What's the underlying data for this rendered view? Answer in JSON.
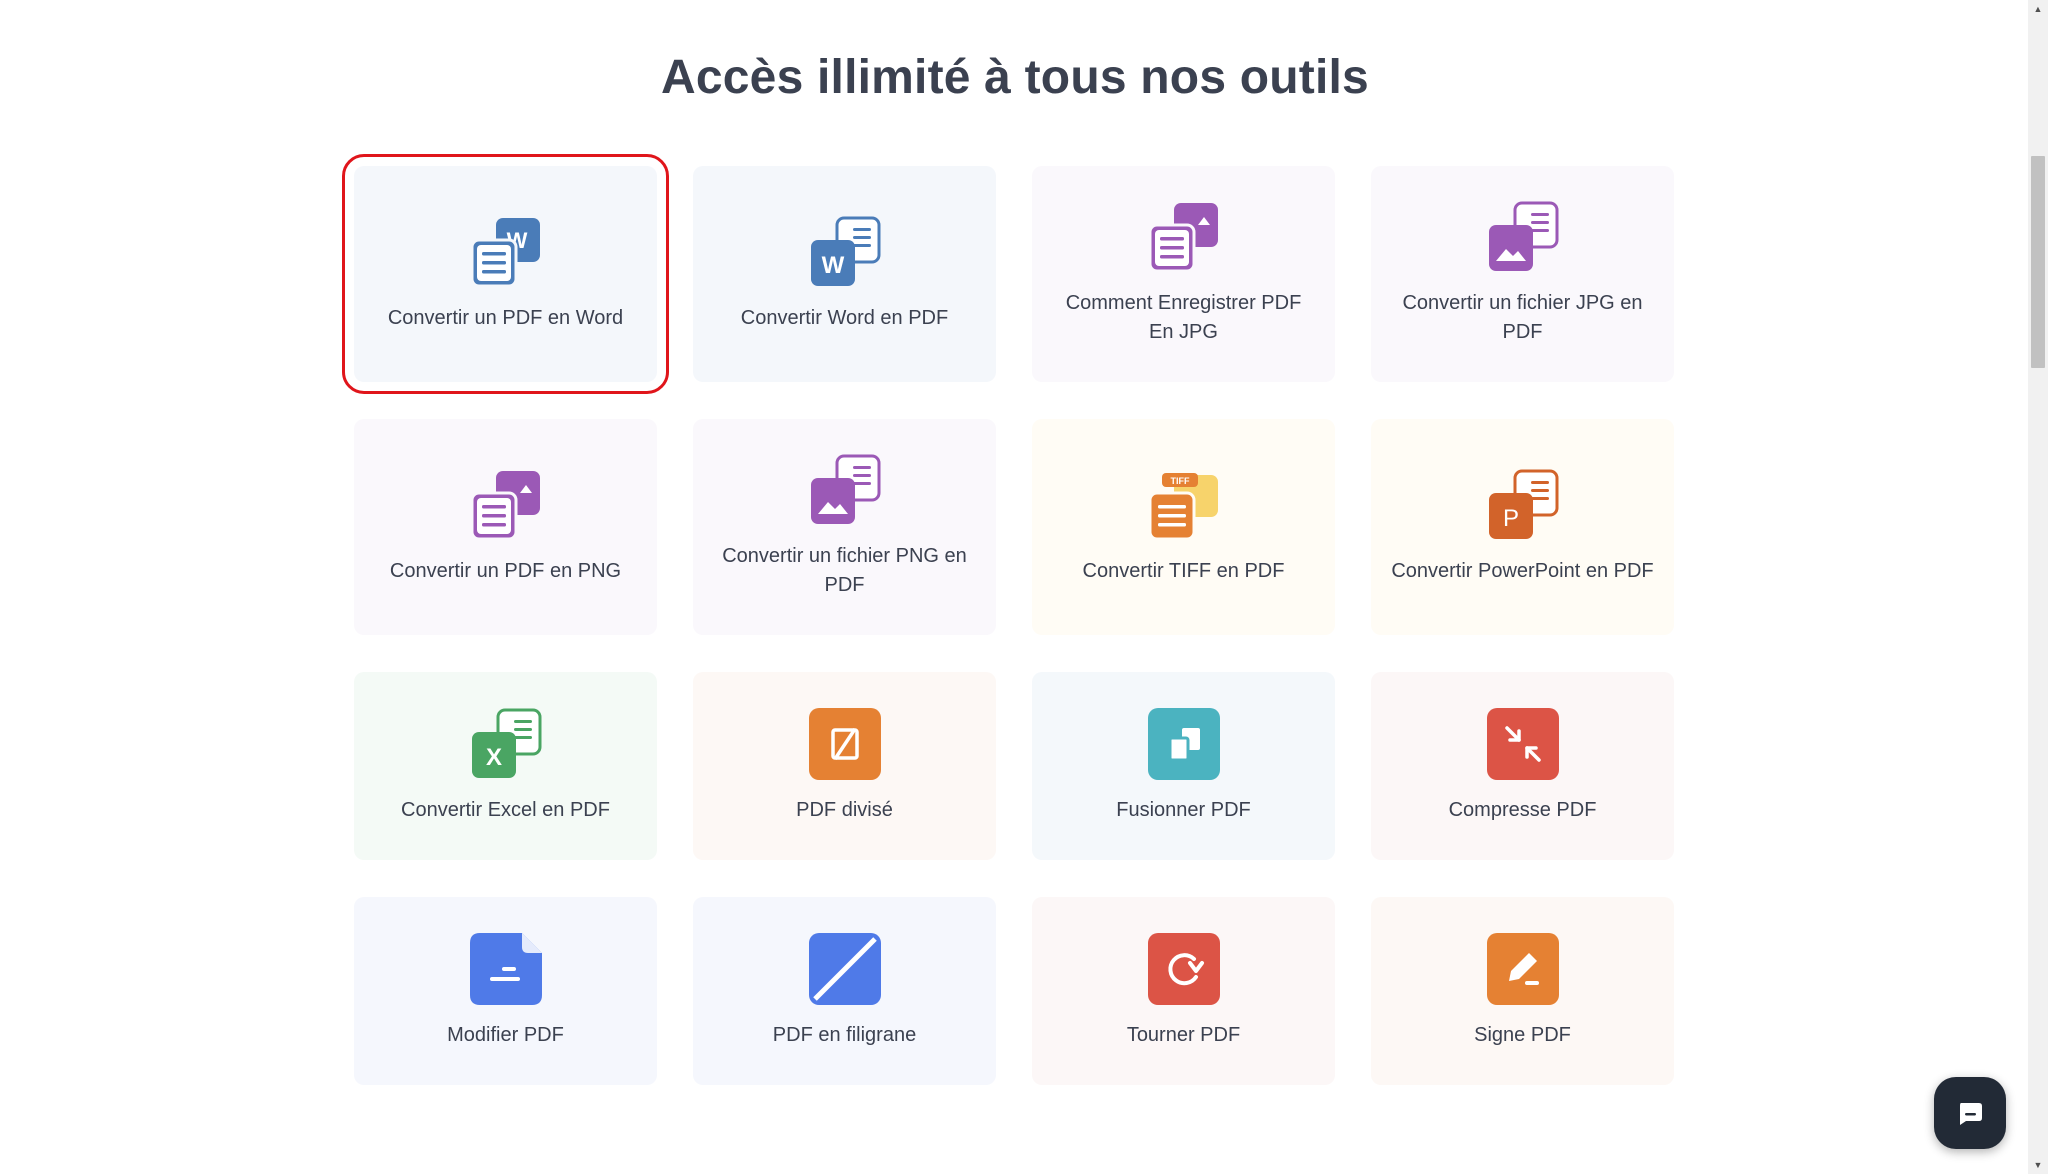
{
  "heading": "Accès illimité à tous nos outils",
  "colors": {
    "highlight": "#e0151b",
    "text": "#3b4150",
    "word_blue": "#4a7cb8",
    "purple": "#9b59b6",
    "orange": "#e58133",
    "green": "#4aa563",
    "teal": "#4bb3c0",
    "red": "#dc5446",
    "indigo": "#4f7ae8"
  },
  "tools": [
    {
      "label": "Convertir un PDF en Word",
      "icon": "pdf-to-word-icon",
      "selected": true
    },
    {
      "label": "Convertir Word en PDF",
      "icon": "word-to-pdf-icon",
      "selected": false
    },
    {
      "label": "Comment Enregistrer PDF En JPG",
      "icon": "pdf-to-jpg-icon",
      "selected": false
    },
    {
      "label": "Convertir un fichier JPG en PDF",
      "icon": "jpg-to-pdf-icon",
      "selected": false
    },
    {
      "label": "Convertir un PDF en PNG",
      "icon": "pdf-to-png-icon",
      "selected": false
    },
    {
      "label": "Convertir un fichier PNG en PDF",
      "icon": "png-to-pdf-icon",
      "selected": false
    },
    {
      "label": "Convertir TIFF en PDF",
      "icon": "tiff-to-pdf-icon",
      "selected": false,
      "badge": "TIFF"
    },
    {
      "label": "Convertir PowerPoint en PDF",
      "icon": "powerpoint-to-pdf-icon",
      "selected": false
    },
    {
      "label": "Convertir Excel en PDF",
      "icon": "excel-to-pdf-icon",
      "selected": false
    },
    {
      "label": "PDF divisé",
      "icon": "split-pdf-icon",
      "selected": false
    },
    {
      "label": "Fusionner PDF",
      "icon": "merge-pdf-icon",
      "selected": false
    },
    {
      "label": "Compresse PDF",
      "icon": "compress-pdf-icon",
      "selected": false
    },
    {
      "label": "Modifier PDF",
      "icon": "edit-pdf-icon",
      "selected": false
    },
    {
      "label": "PDF en filigrane",
      "icon": "watermark-pdf-icon",
      "selected": false
    },
    {
      "label": "Tourner PDF",
      "icon": "rotate-pdf-icon",
      "selected": false
    },
    {
      "label": "Signe PDF",
      "icon": "sign-pdf-icon",
      "selected": false
    }
  ],
  "chat": {
    "icon": "chat-icon"
  },
  "scrollbar": {
    "up_icon": "scroll-up-arrow-icon",
    "down_icon": "scroll-down-arrow-icon",
    "up_glyph": "▲",
    "down_glyph": "▼"
  }
}
